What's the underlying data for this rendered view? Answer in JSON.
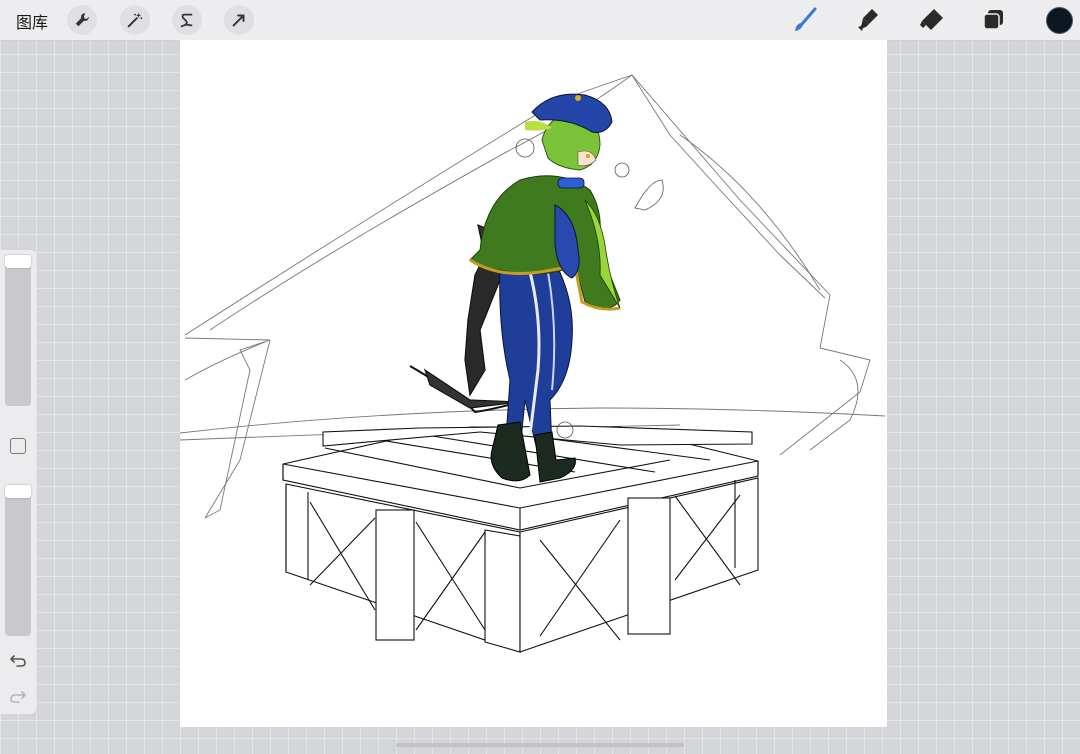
{
  "topbar": {
    "gallery_label": "图库",
    "left_tools": [
      {
        "name": "actions",
        "icon": "wrench-icon"
      },
      {
        "name": "adjustments",
        "icon": "magic-wand-icon"
      },
      {
        "name": "selection",
        "icon": "selection-s-icon"
      },
      {
        "name": "transform",
        "icon": "arrow-cursor-icon"
      }
    ],
    "right_tools": [
      {
        "name": "brush",
        "icon": "brush-icon",
        "active": true
      },
      {
        "name": "smudge",
        "icon": "smudge-icon"
      },
      {
        "name": "eraser",
        "icon": "eraser-icon"
      },
      {
        "name": "layers",
        "icon": "layers-icon"
      }
    ],
    "current_color": "#0b1824",
    "active_tool_color": "#3a78d8"
  },
  "sidebar": {
    "brush_size_level": 1.0,
    "opacity_level": 1.0,
    "undo_icon": "undo-icon",
    "redo_icon": "redo-icon",
    "modifier_icon": "square-modifier-icon"
  },
  "canvas": {
    "background": "#ffffff",
    "artwork": "character-on-crate-illustration"
  }
}
